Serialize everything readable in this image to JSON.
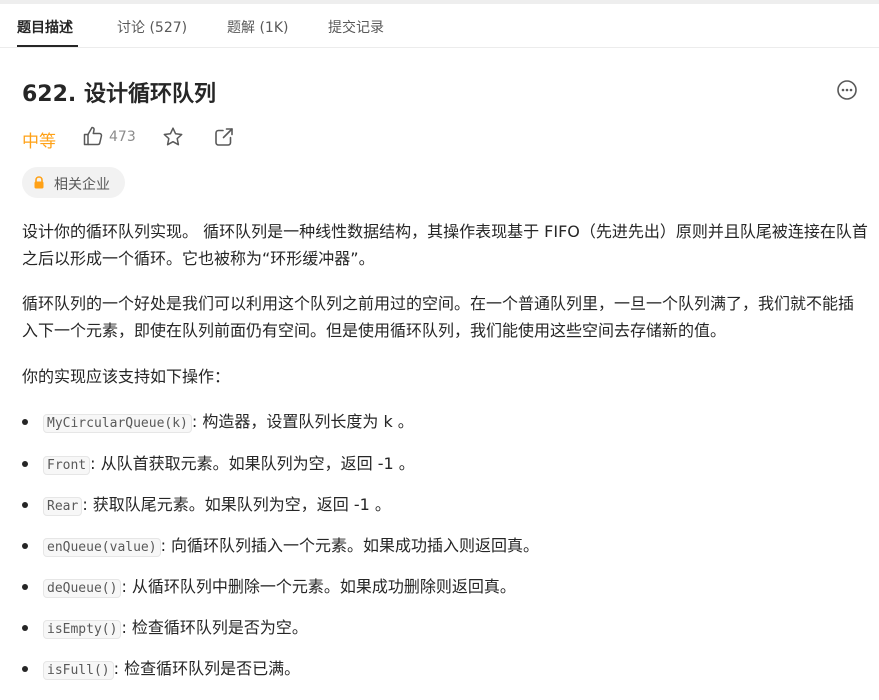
{
  "tabs": [
    {
      "label": "题目描述"
    },
    {
      "label": "讨论 (527)"
    },
    {
      "label": "题解 (1K)"
    },
    {
      "label": "提交记录"
    }
  ],
  "problem": {
    "title": "622. 设计循环队列",
    "difficulty": "中等",
    "likes": "473",
    "company_tag": "相关企业"
  },
  "colors": {
    "difficulty": "#ffa116",
    "text": "#262626",
    "muted": "#8c8c8c"
  },
  "icons": [
    "more-icon",
    "thumbs-up-icon",
    "star-icon",
    "share-icon",
    "lock-icon"
  ],
  "description": {
    "paragraphs": [
      "设计你的循环队列实现。 循环队列是一种线性数据结构，其操作表现基于 FIFO（先进先出）原则并且队尾被连接在队首之后以形成一个循环。它也被称为“环形缓冲器”。",
      "循环队列的一个好处是我们可以利用这个队列之前用过的空间。在一个普通队列里，一旦一个队列满了，我们就不能插入下一个元素，即使在队列前面仍有空间。但是使用循环队列，我们能使用这些空间去存储新的值。",
      "你的实现应该支持如下操作："
    ],
    "operations": [
      {
        "code": "MyCircularQueue(k)",
        "text": ": 构造器，设置队列长度为 k 。"
      },
      {
        "code": "Front",
        "text": ": 从队首获取元素。如果队列为空，返回 -1 。"
      },
      {
        "code": "Rear",
        "text": ": 获取队尾元素。如果队列为空，返回 -1 。"
      },
      {
        "code": "enQueue(value)",
        "text": ": 向循环队列插入一个元素。如果成功插入则返回真。"
      },
      {
        "code": "deQueue()",
        "text": ": 从循环队列中删除一个元素。如果成功删除则返回真。"
      },
      {
        "code": "isEmpty()",
        "text": ": 检查循环队列是否为空。"
      },
      {
        "code": "isFull()",
        "text": ": 检查循环队列是否已满。"
      }
    ]
  }
}
